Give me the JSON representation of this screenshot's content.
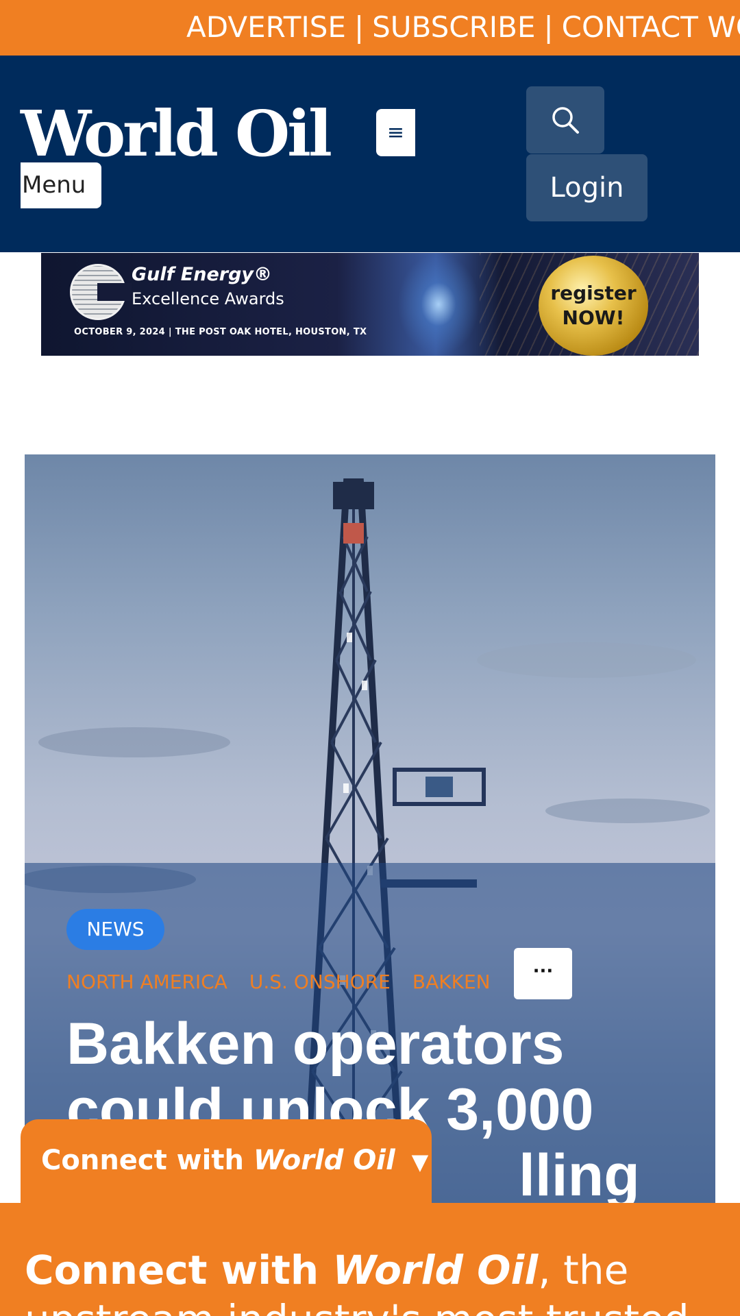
{
  "topbar": {
    "links": [
      "ADVERTISE",
      "SUBSCRIBE",
      "CONTACT WO"
    ],
    "separator": "|"
  },
  "header": {
    "logo_text": "World Oil",
    "menu_label": "Menu",
    "hamburger_icon": "≡",
    "search_icon": "search-icon",
    "login_label": "Login",
    "colors": {
      "background": "#002b5c",
      "button": "#2e5077"
    }
  },
  "ad": {
    "title": "Gulf Energy®",
    "subtitle": "Excellence Awards",
    "date_line": "OCTOBER 9, 2024 | THE POST OAK HOTEL, HOUSTON, TX",
    "cta_line1": "register",
    "cta_line2": "NOW!"
  },
  "article": {
    "category": "NEWS",
    "tags": [
      "NORTH AMERICA",
      "U.S. ONSHORE",
      "BAKKEN"
    ],
    "more_label": "···",
    "headline": "Bakken operators could unlock 3,000 ... drilling",
    "headline_lines": [
      "Bakken operators",
      "could unlock 3,000",
      "lling"
    ]
  },
  "connect": {
    "tab_label_prefix": "Connect with ",
    "tab_label_brand": "World Oil",
    "tab_arrow": "▼",
    "panel_prefix": "Connect with ",
    "panel_brand": "World Oil",
    "panel_suffix": ", the",
    "panel_line2": "upstream industry's most trusted"
  },
  "colors": {
    "accent_orange": "#f07f22",
    "navy": "#002b5c",
    "news_badge": "#2b7de4"
  }
}
